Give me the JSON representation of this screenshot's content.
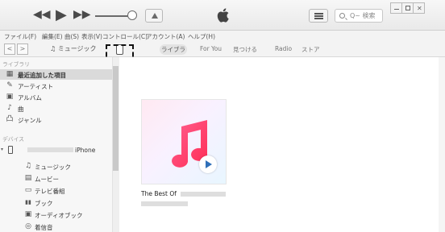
{
  "player": {
    "icons": [
      "rewind-icon",
      "play-icon",
      "fast-forward-icon",
      "volume-slider",
      "airplay-icon",
      "apple-logo",
      "list-icon",
      "search-icon"
    ],
    "search_placeholder": "Q~ 検索"
  },
  "menu": [
    "ファイル(F)",
    "編集(E)",
    "曲(S)",
    "表示(V)",
    "コントロール(C)",
    "アカウント(A)",
    "ヘルプ(H)"
  ],
  "navbar": {
    "back": "<",
    "forward": ">",
    "media_select": "♫ ミュージック",
    "tabs": [
      "ライブラリ",
      "For You",
      "見つける",
      "Radio",
      "ストア"
    ]
  },
  "callout": "①",
  "sidebar": {
    "library_header": "ライブラリ",
    "library_items": [
      {
        "icon": "▦",
        "label": "最近追加した項目"
      },
      {
        "icon": "✎",
        "label": "アーティスト"
      },
      {
        "icon": "▣",
        "label": "アルバム"
      },
      {
        "icon": "♪",
        "label": "曲"
      },
      {
        "icon": "凸",
        "label": "ジャンル"
      }
    ],
    "devices_header": "デバイス",
    "device_name": "iPhone",
    "device_items": [
      {
        "icon": "♫",
        "label": "ミュージック"
      },
      {
        "icon": "▤",
        "label": "ムービー"
      },
      {
        "icon": "▭",
        "label": "テレビ番組"
      },
      {
        "icon": "▮▮",
        "label": "ブック"
      },
      {
        "icon": "▣",
        "label": "オーディオブック"
      },
      {
        "icon": "◎",
        "label": "着信音"
      }
    ]
  },
  "main": {
    "album_title": "The Best Of"
  }
}
